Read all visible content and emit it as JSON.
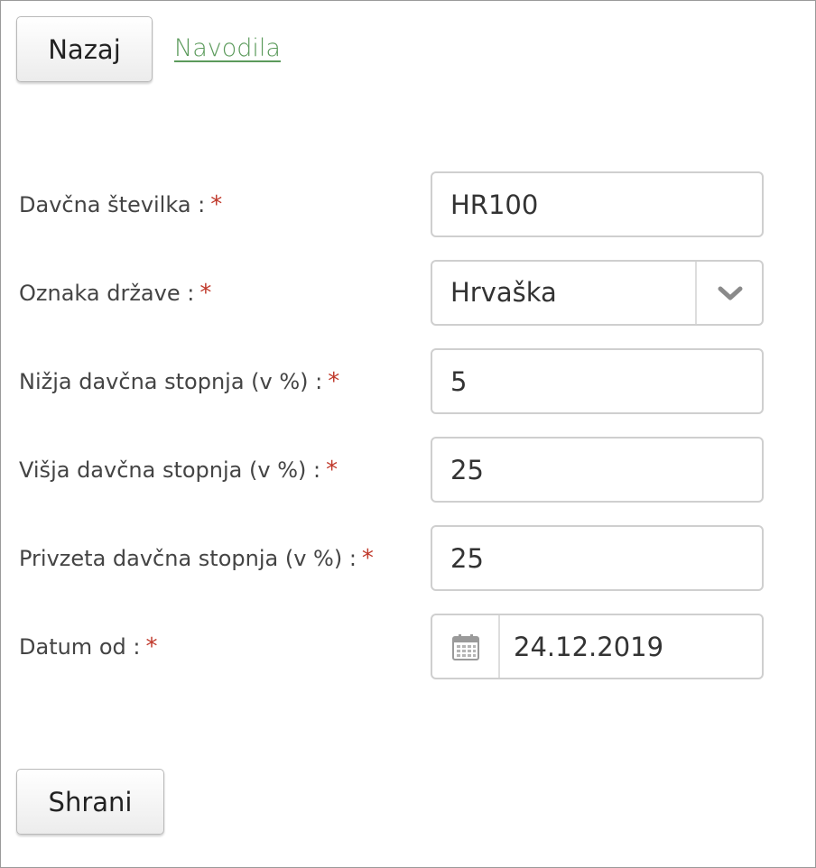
{
  "toolbar": {
    "back_label": "Nazaj",
    "help_link": "Navodila"
  },
  "form": {
    "required_mark": "*",
    "tax_number": {
      "label": "Davčna številka :",
      "value": "HR100"
    },
    "country": {
      "label": "Oznaka države :",
      "value": "Hrvaška",
      "icon": "chevron-down-icon"
    },
    "lower_rate": {
      "label": "Nižja davčna stopnja (v %) :",
      "value": "5"
    },
    "higher_rate": {
      "label": "Višja davčna stopnja (v %) :",
      "value": "25"
    },
    "default_rate": {
      "label": "Privzeta davčna stopnja (v %) :",
      "value": "25"
    },
    "date_from": {
      "label": "Datum od :",
      "value": "24.12.2019",
      "icon": "calendar-icon"
    }
  },
  "actions": {
    "save_label": "Shrani"
  },
  "colors": {
    "required": "#c0392b",
    "link": "#5b9a5b",
    "border": "#cfcfcf"
  }
}
